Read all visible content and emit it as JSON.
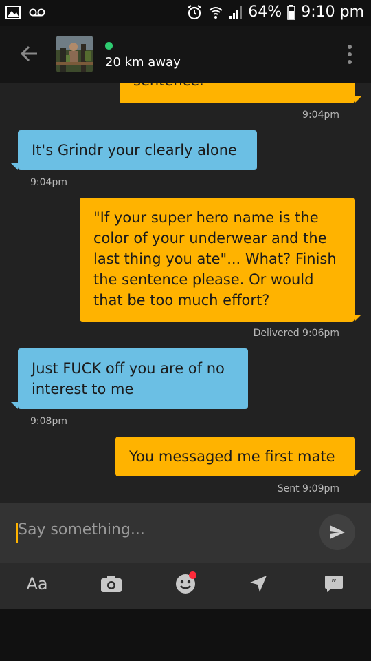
{
  "status_bar": {
    "battery": "64%",
    "time": "9:10 pm",
    "icons": [
      "image-icon",
      "voicemail-icon",
      "alarm-icon",
      "wifi-icon",
      "signal-icon",
      "battery-icon"
    ]
  },
  "header": {
    "distance": "20 km away",
    "online_color": "#2ecc71"
  },
  "messages": [
    {
      "direction": "out",
      "text": "sentence.",
      "time": "9:04pm"
    },
    {
      "direction": "in",
      "text": "It's Grindr your clearly alone",
      "time": "9:04pm"
    },
    {
      "direction": "out",
      "text": "\"If your super hero name is the color of your underwear and the last thing you ate\"... What? Finish the sentence please. Or would that be too much effort?",
      "time": "Delivered 9:06pm"
    },
    {
      "direction": "in",
      "text": "Just FUCK off you are of no interest to me",
      "time": "9:08pm"
    },
    {
      "direction": "out",
      "text": "You messaged me first mate",
      "time": "Sent 9:09pm"
    }
  ],
  "composer": {
    "placeholder": "Say something...",
    "font_button_label": "Aa"
  },
  "colors": {
    "outgoing_bubble": "#ffb300",
    "incoming_bubble": "#6bbfe4",
    "notification_dot": "#ff2a3a"
  }
}
